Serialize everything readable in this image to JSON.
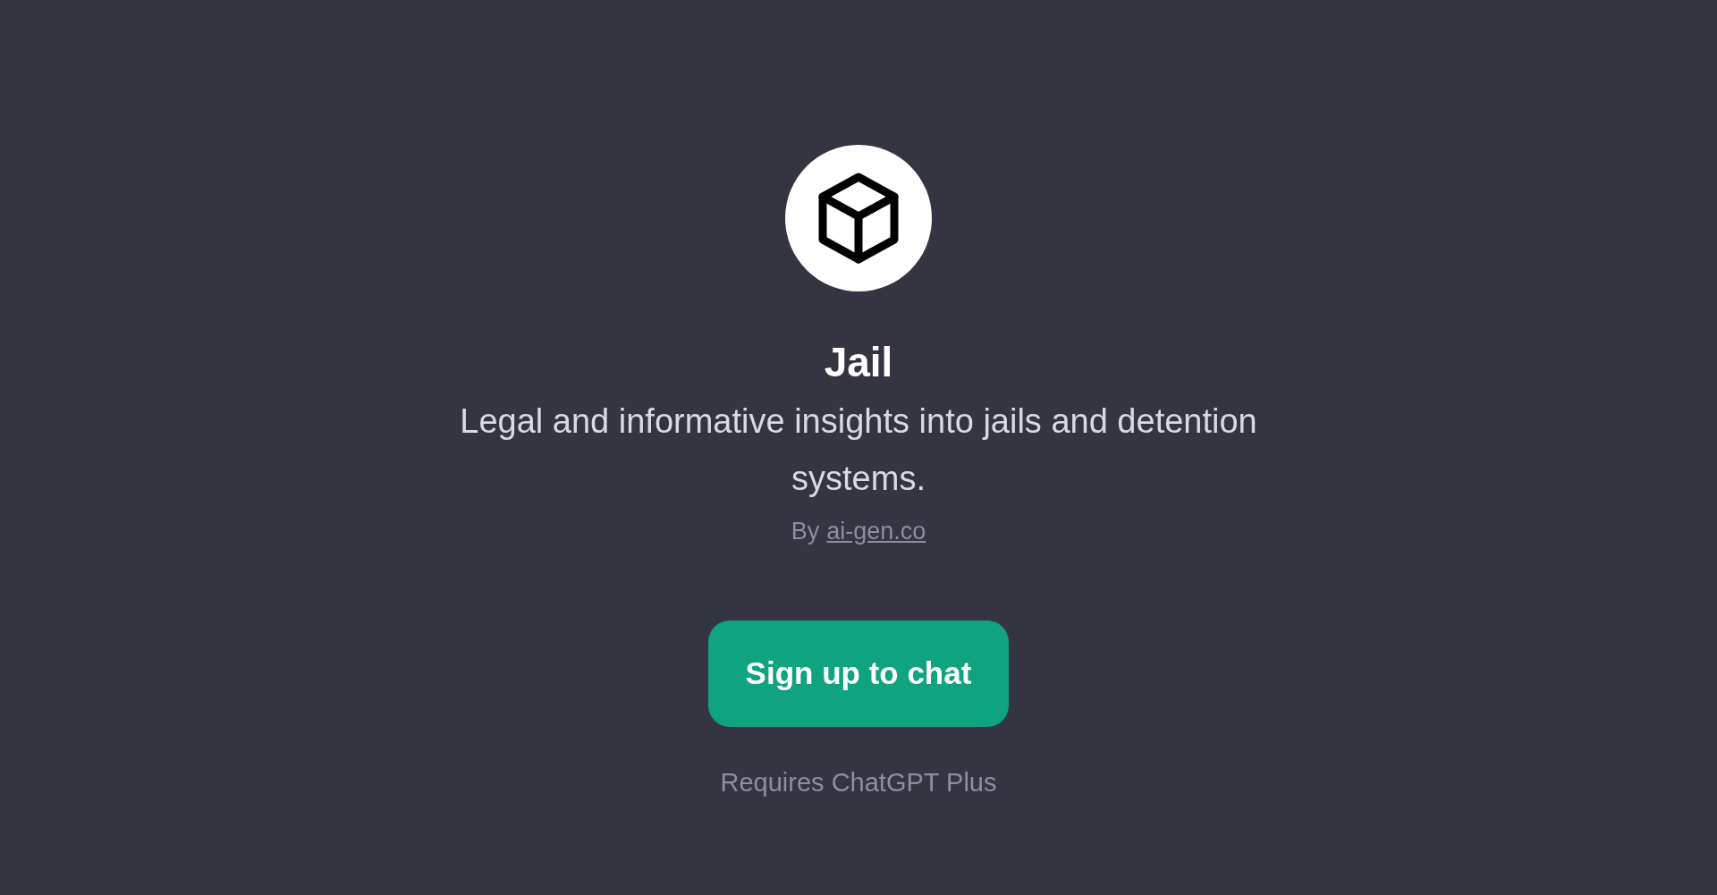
{
  "title": "Jail",
  "description": "Legal and informative insights into jails and detention systems.",
  "author": {
    "prefix": "By",
    "link": "ai-gen.co"
  },
  "button": "Sign up to chat",
  "note": "Requires ChatGPT Plus"
}
